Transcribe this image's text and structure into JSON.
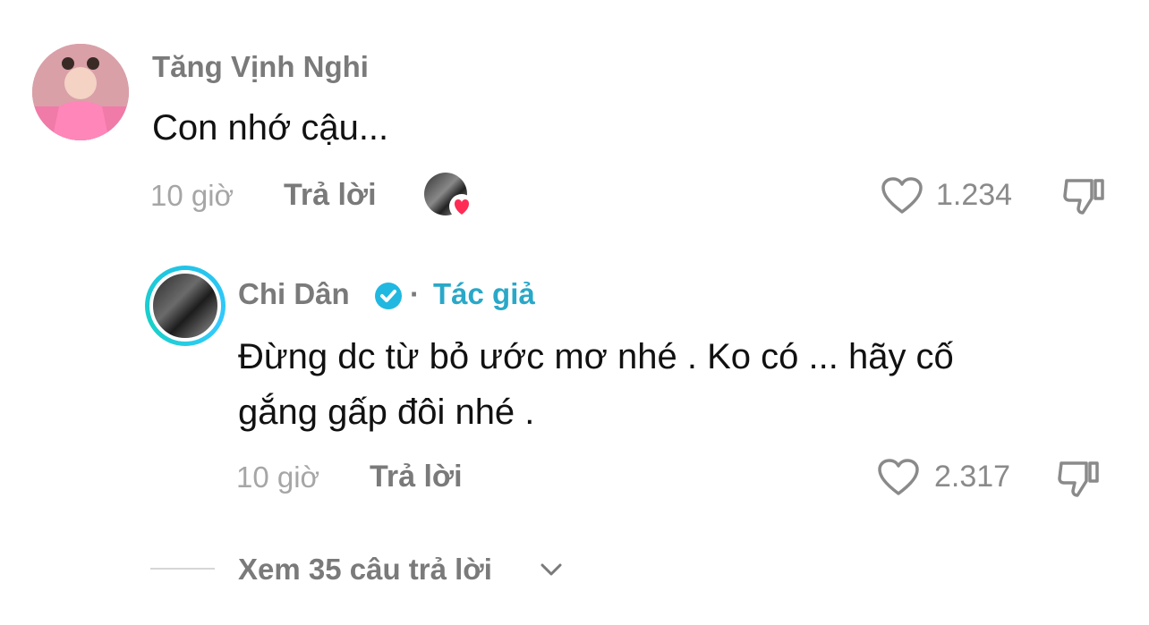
{
  "comment": {
    "username": "Tăng Vịnh Nghi",
    "text": "Con nhớ cậu...",
    "time": "10 giờ",
    "reply_label": "Trả lời",
    "likes": "1.234"
  },
  "reply": {
    "username": "Chi Dân",
    "author_label": "Tác giả",
    "separator": "·",
    "text_line1": "Đừng dc từ bỏ ước mơ nhé . Ko có ... hãy cố",
    "text_line2": "gắng gấp đôi nhé .",
    "time": "10 giờ",
    "reply_label": "Trả lời",
    "likes": "2.317"
  },
  "view_replies": {
    "label": "Xem 35 câu trả lời"
  },
  "colors": {
    "accent": "#2aa8c8",
    "verified": "#20b8e0",
    "heart_badge": "#fe2c55"
  },
  "icons": [
    "heart-outline-icon",
    "dislike-icon",
    "verified-badge-icon",
    "chevron-down-icon",
    "heart-badge-icon"
  ]
}
